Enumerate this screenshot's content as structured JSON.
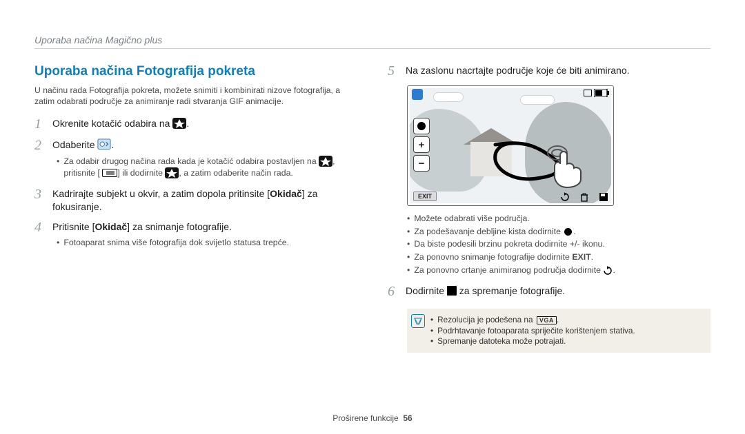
{
  "header": {
    "running_title": "Uporaba načina Magično plus"
  },
  "section": {
    "heading": "Uporaba načina Fotografija pokreta"
  },
  "intro": "U načinu rada Fotografija pokreta, možete snimiti i kombinirati nizove fotografija, a zatim odabrati područje za animiranje radi stvaranja GIF animacije.",
  "steps_left": {
    "1": {
      "text": "Okrenite kotačić odabira na "
    },
    "2": {
      "text": "Odaberite ",
      "note_a": "Za odabir drugog načina rada kada je kotačić odabira postavljen na ",
      "note_b": ", pritisnite [",
      "note_c": "] ili dodirnite ",
      "note_d": ", a zatim odaberite način rada."
    },
    "3": {
      "text_a": "Kadrirajte subjekt u okvir, a zatim dopola pritinsite [",
      "shutter1": "Okidač",
      "text_b": "] za fokusiranje."
    },
    "4": {
      "text_a": "Pritisnite [",
      "shutter2": "Okidač",
      "text_b": "] za snimanje fotografije.",
      "note": "Fotoaparat snima više fotografija dok svijetlo statusa trepće."
    }
  },
  "steps_right": {
    "5": {
      "text": "Na zaslonu nacrtajte područje koje će biti animirano.",
      "exit_label": "EXIT",
      "bullets": [
        "Možete odabrati više područja.",
        "Za podešavanje debljine kista dodirnite ",
        "Da biste podesili brzinu pokreta dodirnite +/- ikonu.",
        "Za ponovno snimanje fotografije dodirnite ",
        "Za ponovno crtanje animiranog područja dodirnite "
      ],
      "exit_word": "EXIT"
    },
    "6": {
      "text_a": "Dodirnite ",
      "text_b": " za spremanje fotografije."
    },
    "notes": [
      "Rezolucija je podešena na ",
      "Podrhtavanje fotoaparata spriječite korištenjem stativa.",
      "Spremanje datoteka može potrajati."
    ],
    "vga": "VGA"
  },
  "footer": {
    "label": "Proširene funkcije",
    "page": "56"
  }
}
